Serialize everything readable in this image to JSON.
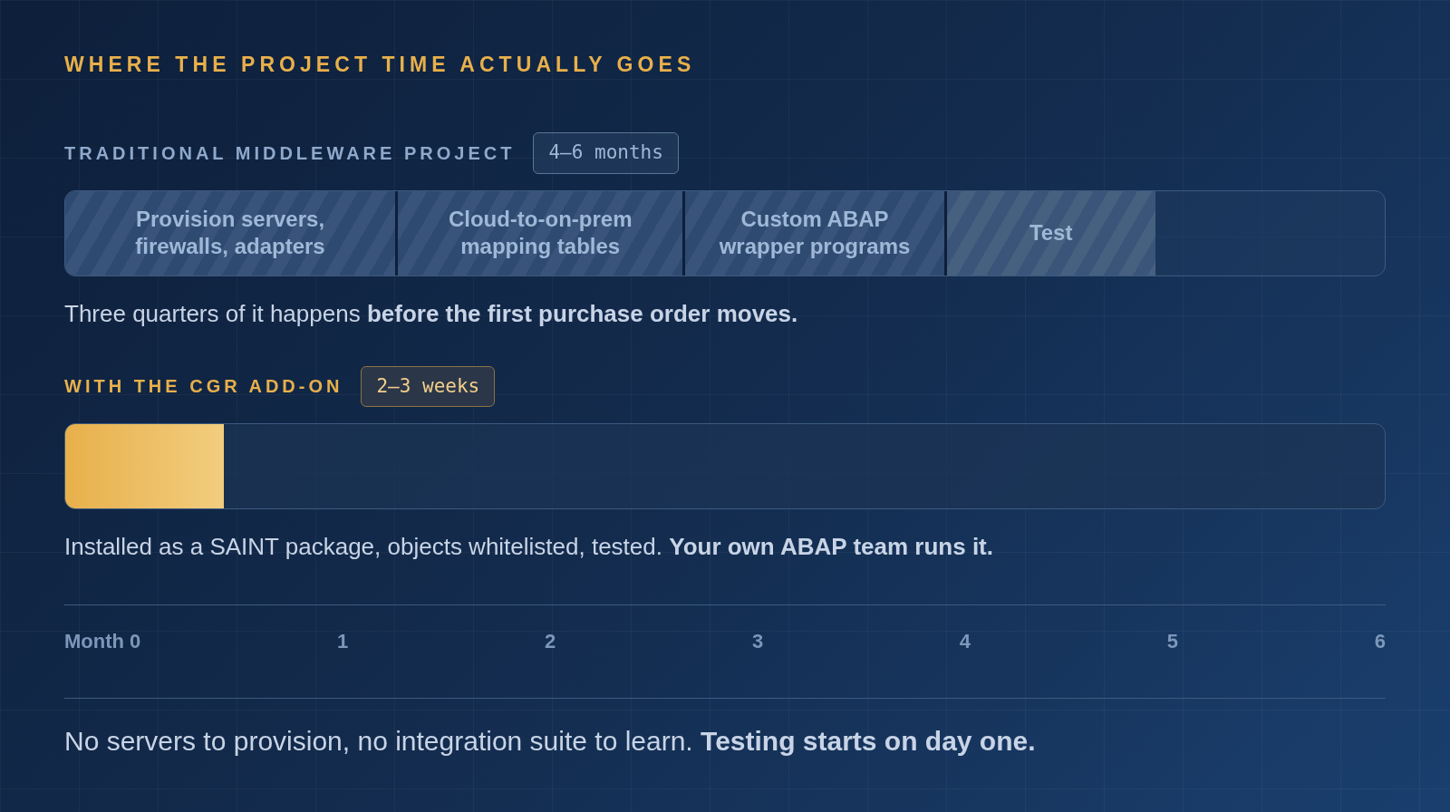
{
  "title": "WHERE THE PROJECT TIME ACTUALLY GOES",
  "traditional": {
    "label": "TRADITIONAL MIDDLEWARE PROJECT",
    "badge": "4–6 months",
    "segments": [
      {
        "label": "Provision servers,\nfirewalls, adapters",
        "kind": "work"
      },
      {
        "label": "Cloud-to-on-prem\nmapping tables",
        "kind": "work"
      },
      {
        "label": "Custom ABAP\nwrapper programs",
        "kind": "work"
      },
      {
        "label": "Test",
        "kind": "test"
      }
    ],
    "note": "Three quarters of it happens **before the first purchase order moves.**"
  },
  "addon": {
    "label": "WITH THE CGR ADD-ON",
    "badge": "2–3 weeks",
    "level": 0.12,
    "note": "Installed as a SAINT package, objects whitelisted, tested. **Your own ABAP team runs it.**"
  },
  "axis": {
    "ticks": [
      "Month 0",
      "1",
      "2",
      "3",
      "4",
      "5",
      "6"
    ]
  },
  "footer": "No servers to provision, no integration suite to learn. **Testing starts on day one.**"
}
